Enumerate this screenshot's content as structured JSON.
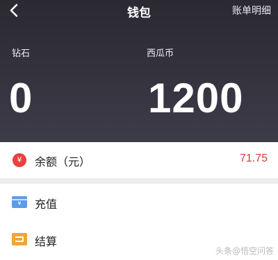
{
  "header": {
    "title": "钱包",
    "detail_link": "账单明细",
    "back_icon": "chevron-left-icon"
  },
  "balances": {
    "diamond": {
      "label": "钻石",
      "value": "0"
    },
    "melon": {
      "label": "西瓜币",
      "value": "1200"
    }
  },
  "balance_row": {
    "icon": "yen-icon",
    "icon_glyph": "¥",
    "label": "余额（元）",
    "value": "71.75",
    "accent_color": "#e8413f"
  },
  "menu": {
    "recharge": {
      "label": "充值",
      "icon": "recharge-card-icon",
      "icon_glyph": "¥"
    },
    "settle": {
      "label": "结算",
      "icon": "wallet-icon"
    }
  },
  "watermark": "头条@悟空问答"
}
